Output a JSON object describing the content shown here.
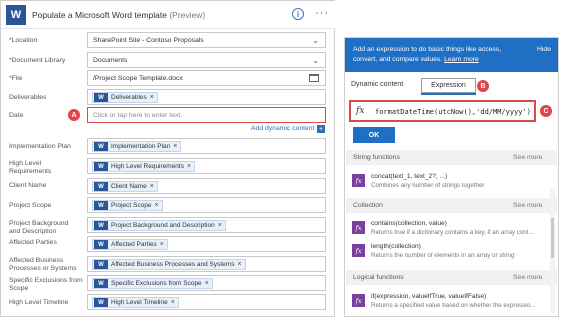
{
  "header": {
    "title": "Populate a Microsoft Word template",
    "preview": "(Preview)"
  },
  "fields": {
    "location": {
      "label": "*Location",
      "value": "SharePoint Site - Contoso Proposals"
    },
    "library": {
      "label": "*Document Library",
      "value": "Documents"
    },
    "file": {
      "label": "*File",
      "value": "/Project Scope Template.docx"
    },
    "deliverables": {
      "label": "Deliverables",
      "token": "Deliverables"
    },
    "date": {
      "label": "Date",
      "placeholder": "Click or tap here to enter text.",
      "badge": "A"
    },
    "add_dynamic": "Add dynamic content",
    "impl": {
      "label": "Implementation Plan",
      "token": "Implementation Plan"
    },
    "hlr": {
      "label": "High Level Requirements",
      "token": "High Level Requirements"
    },
    "client": {
      "label": "Client Name",
      "token": "Client Name"
    },
    "scope": {
      "label": "Project Scope",
      "token": "Project Scope"
    },
    "background": {
      "label": "Project Background and Description",
      "token": "Project Background and Description"
    },
    "parties": {
      "label": "Affected Parties",
      "token": "Affected Parties"
    },
    "business": {
      "label": "Affected Business Processes or Systems",
      "token": "Affected Business Processes and Systems"
    },
    "exclusions": {
      "label": "Specific Exclusions from Scope",
      "token": "Specific Exclusions from Scope"
    },
    "timeline": {
      "label": "High Level Timeline",
      "token": "High Level Timeline"
    }
  },
  "panel": {
    "intro": "Add an expression to do basic things like access, convert, and compare values.",
    "learn_more": "Learn more",
    "hide": "Hide",
    "tab_dynamic": "Dynamic content",
    "tab_expression": "Expression",
    "badge_b": "B",
    "badge_c": "C",
    "expression": "formatDateTime(utcNow(),'dd/MM/yyyy')",
    "ok": "OK",
    "sections": {
      "string": {
        "title": "String functions",
        "more": "See more"
      },
      "collection": {
        "title": "Collection",
        "more": "See more"
      },
      "logical": {
        "title": "Logical functions",
        "more": "See more"
      }
    },
    "functions": {
      "concat": {
        "name": "concat(text_1, text_2?, ...)",
        "desc": "Combines any number of strings together"
      },
      "contains": {
        "name": "contains(collection, value)",
        "desc": "Returns true if a dictionary contains a key, if an array cont..."
      },
      "length": {
        "name": "length(collection)",
        "desc": "Returns the number of elements in an array or string"
      },
      "if": {
        "name": "if(expression, valueIfTrue, valueIfFalse)",
        "desc": "Returns a specified value based on whether the expressio..."
      }
    }
  },
  "colors": {
    "accent": "#1f6fc5",
    "word": "#2b579a",
    "badge": "#e0454a",
    "function_icon": "#7b3f9e"
  },
  "icons": [
    "word-icon",
    "info-icon",
    "more-icon",
    "chevron-down-icon",
    "folder-icon",
    "fx-icon",
    "function-icon",
    "remove-icon"
  ]
}
